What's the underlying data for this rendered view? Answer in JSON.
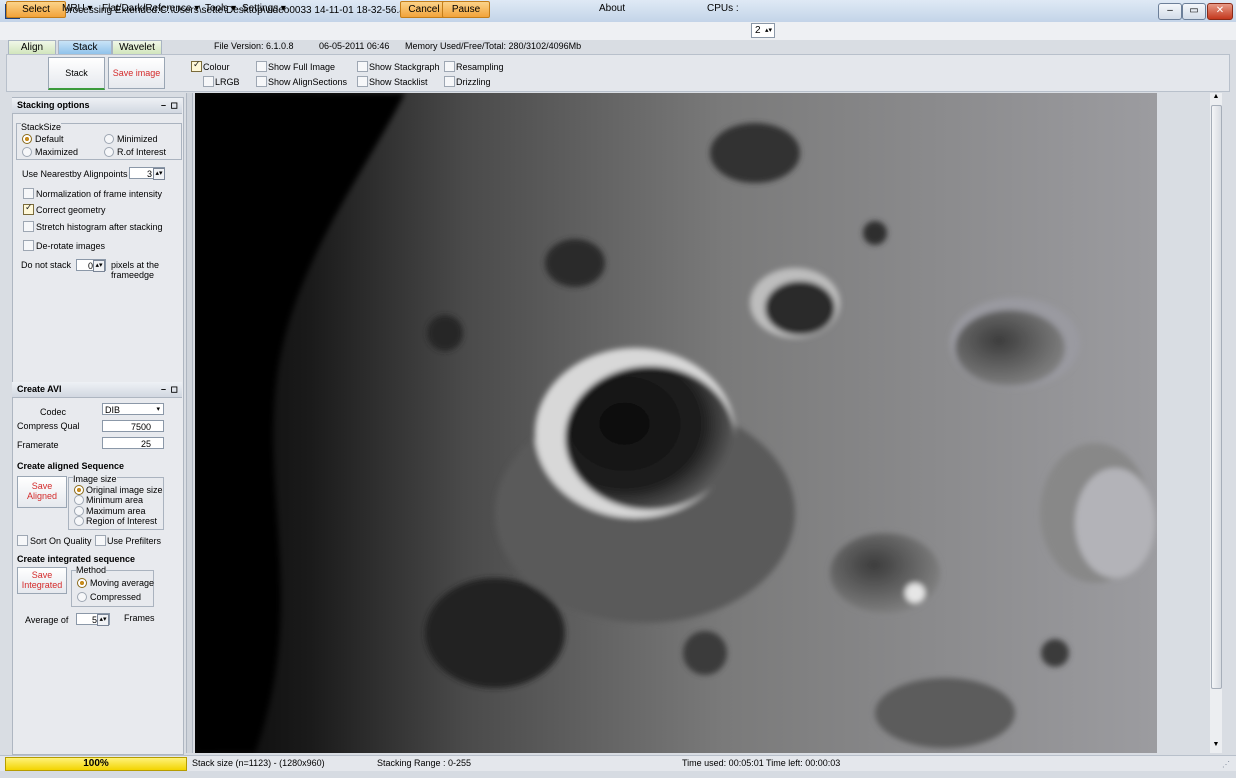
{
  "window": {
    "title": "Registax processing Extended:C:\\Users\\sette\\Desktop\\video0033 14-11-01 18-32-56.avi frame 971",
    "minimize": "‒",
    "maximize": "▭",
    "close": "✕"
  },
  "menubar": {
    "select": "Select",
    "mru": "MRU",
    "flat": "Flat/Dark/Reference",
    "tools": "Tools",
    "settings": "Settings",
    "cancel": "Cancel",
    "pause": "Pause",
    "about": "About",
    "cpus_label": "CPUs :",
    "cpus_value": "2"
  },
  "tabs": [
    "Align",
    "Stack",
    "Wavelet"
  ],
  "info": {
    "version": "File Version: 6.1.0.8",
    "date": "06-05-2011 06:46",
    "memory": "Memory Used/Free/Total: 280/3102/4096Mb"
  },
  "toolbar": {
    "stack": "Stack",
    "save_image": "Save image",
    "colour": "Colour",
    "lrgb": "LRGB",
    "show_full_image": "Show Full Image",
    "show_alignsections": "Show AlignSections",
    "show_stackgraph": "Show Stackgraph",
    "show_stacklist": "Show Stacklist",
    "resampling": "Resampling",
    "drizzling": "Drizzling"
  },
  "stacking_options": {
    "header": "Stacking options",
    "stacksize_label": "StackSize",
    "default": "Default",
    "minimized": "Minimized",
    "maximized": "Maximized",
    "roi": "R.of Interest",
    "nearest_label": "Use Nearestby Alignpoints",
    "nearest_value": "3",
    "normalization": "Normalization of frame intensity",
    "correct_geometry": "Correct geometry",
    "stretch": "Stretch histogram after stacking",
    "derotate": "De-rotate images",
    "do_not_stack": "Do not stack",
    "do_not_stack_value": "0",
    "pixels_at": "pixels at the",
    "frameedge": "frameedge"
  },
  "create_avi": {
    "header": "Create AVI",
    "codec_label": "Codec",
    "codec_value": "DIB",
    "compress_label": "Compress Qual",
    "compress_value": "7500",
    "framerate_label": "Framerate",
    "framerate_value": "25",
    "aligned_heading": "Create aligned Sequence",
    "save_aligned_1": "Save",
    "save_aligned_2": "Aligned",
    "image_size_label": "Image size",
    "original_size": "Original image size",
    "minimum_area": "Minimum area",
    "maximum_area": "Maximum area",
    "region_of_interest": "Region of Interest",
    "sort_on_quality": "Sort On Quality",
    "use_prefilters": "Use Prefilters",
    "integrated_heading": "Create integrated sequence",
    "save_integrated_1": "Save",
    "save_integrated_2": "Integrated",
    "method_label": "Method",
    "moving_average": "Moving average",
    "compressed": "Compressed",
    "average_of": "Average of",
    "average_value": "5",
    "frames": "Frames"
  },
  "status": {
    "progress": "100%",
    "progress_fraction": 1.0,
    "stack_size": "Stack size (n=1123) - (1280x960)",
    "stacking_range": "Stacking Range : 0-255",
    "time": "Time used: 00:05:01 Time left: 00:00:03"
  }
}
